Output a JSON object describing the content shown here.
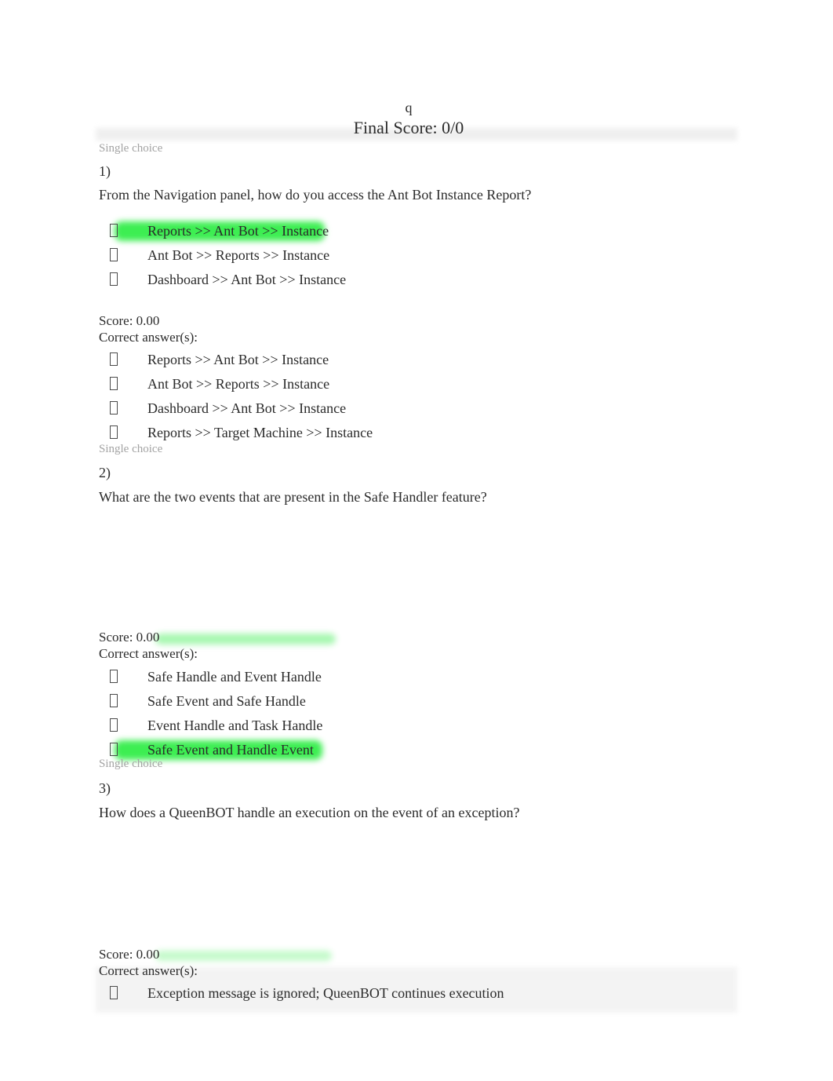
{
  "document": {
    "title": "q",
    "final_score_label": "Final Score: 0/0"
  },
  "labels": {
    "single_choice": "Single choice",
    "score_prefix": "Score: 0.00",
    "correct_answers": "Correct answer(s):",
    "bullet_glyph": "missing-glyph-box"
  },
  "colors": {
    "highlight_green": "#3dee52",
    "muted_gray": "#a3a3a3",
    "text": "#2b2b2b",
    "band_gray": "#f3f3f3"
  },
  "questions": [
    {
      "type": "Single choice",
      "number": "1)",
      "text": "From the Navigation panel, how do you access the Ant Bot Instance Report?",
      "score": "Score: 0.00",
      "correct_label": "Correct answer(s):",
      "selected_options": [
        {
          "label": "Reports >> Ant Bot >> Instance",
          "highlighted": true
        },
        {
          "label": "Ant Bot >> Reports >> Instance",
          "highlighted": false
        },
        {
          "label": "Dashboard >> Ant Bot >> Instance",
          "highlighted": false
        }
      ],
      "correct_options": [
        {
          "label": "Reports >> Ant Bot >> Instance",
          "highlighted": false
        },
        {
          "label": "Ant Bot >> Reports >> Instance",
          "highlighted": false
        },
        {
          "label": "Dashboard >> Ant Bot >> Instance",
          "highlighted": false
        },
        {
          "label": "Reports >> Target Machine >> Instance",
          "highlighted": false
        }
      ]
    },
    {
      "type": "Single choice",
      "number": "2)",
      "text": "What are the two events that are present in the Safe Handler feature?",
      "score": "Score: 0.00",
      "correct_label": "Correct answer(s):",
      "selected_options": [],
      "correct_options": [
        {
          "label": "Safe Handle and Event Handle",
          "highlighted": false
        },
        {
          "label": "Safe Event and Safe Handle",
          "highlighted": false
        },
        {
          "label": "Event Handle and Task Handle",
          "highlighted": false
        },
        {
          "label": "Safe Event and Handle Event",
          "highlighted": true
        }
      ]
    },
    {
      "type": "Single choice",
      "number": "3)",
      "text": "How does a QueenBOT handle an execution on the event of an exception?",
      "score": "Score: 0.00",
      "correct_label": "Correct answer(s):",
      "selected_options": [],
      "correct_options": [
        {
          "label": "Exception message is ignored; QueenBOT continues execution",
          "highlighted": false
        }
      ]
    }
  ]
}
